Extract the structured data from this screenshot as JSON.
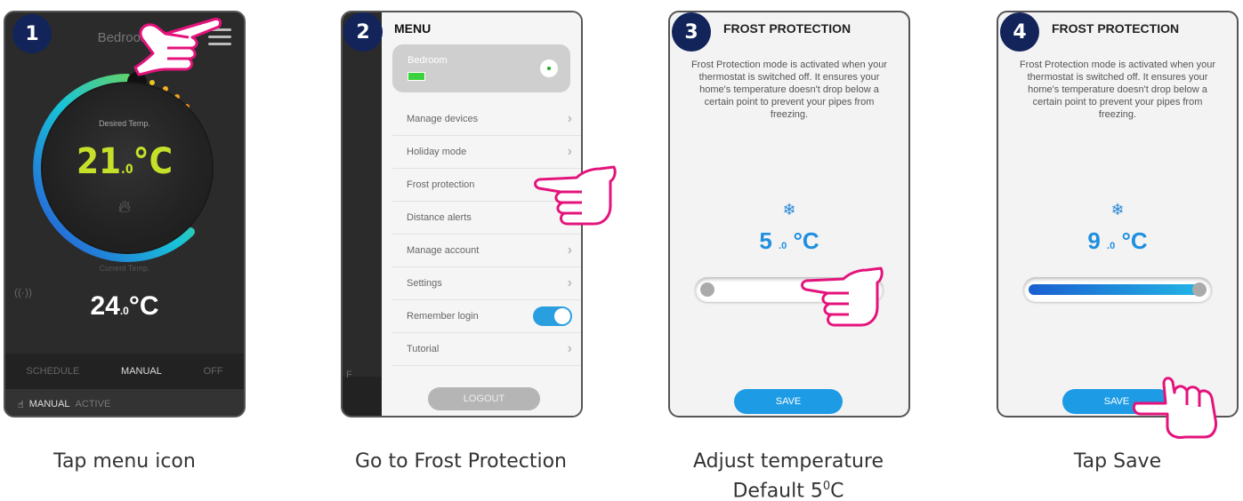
{
  "steps": [
    {
      "number": "1",
      "caption": "Tap menu icon"
    },
    {
      "number": "2",
      "caption": "Go to Frost Protection"
    },
    {
      "number": "3",
      "caption_line1": "Adjust temperature",
      "caption_line2": "Default 5",
      "caption_sup": "0",
      "caption_unit": "C"
    },
    {
      "number": "4",
      "caption": "Tap Save"
    }
  ],
  "screen1": {
    "room": "Bedroom",
    "desired_label": "Desired Temp.",
    "desired_int": "21",
    "desired_dec": ".0",
    "desired_unit": "°C",
    "current_label": "Current Temp.",
    "current_int": "24",
    "current_dec": ".0",
    "current_unit": "°C",
    "wifi_icon": "((·))",
    "modes": [
      "SCHEDULE",
      "MANUAL",
      "OFF"
    ],
    "status_mode": "MANUAL",
    "status_state": "ACTIVE"
  },
  "screen2": {
    "title": "MENU",
    "room": "Bedroom",
    "items": [
      "Manage devices",
      "Holiday mode",
      "Frost protection",
      "Distance alerts",
      "Manage account",
      "Settings",
      "Remember login",
      "Tutorial"
    ],
    "logout": "LOGOUT",
    "strip_text": "F"
  },
  "screen3": {
    "title": "FROST PROTECTION",
    "description": "Frost Protection mode is activated when your thermostat is switched off. It ensures your home's temperature doesn't drop below a certain point to prevent your pipes from freezing.",
    "temp_int": "5",
    "temp_dec": ".0",
    "temp_unit": "°C",
    "slider_fraction": 0.0,
    "save": "SAVE"
  },
  "screen4": {
    "title": "FROST PROTECTION",
    "description": "Frost Protection mode is activated when your thermostat is switched off. It ensures your home's temperature doesn't drop below a certain point to prevent your pipes from freezing.",
    "temp_int": "9",
    "temp_dec": ".0",
    "temp_unit": "°C",
    "slider_fraction": 1.0,
    "save": "SAVE"
  },
  "colors": {
    "badge": "#12245a",
    "accent_blue": "#1e9be5",
    "desired_green": "#c6e02a",
    "hand_outline": "#e4137b"
  }
}
